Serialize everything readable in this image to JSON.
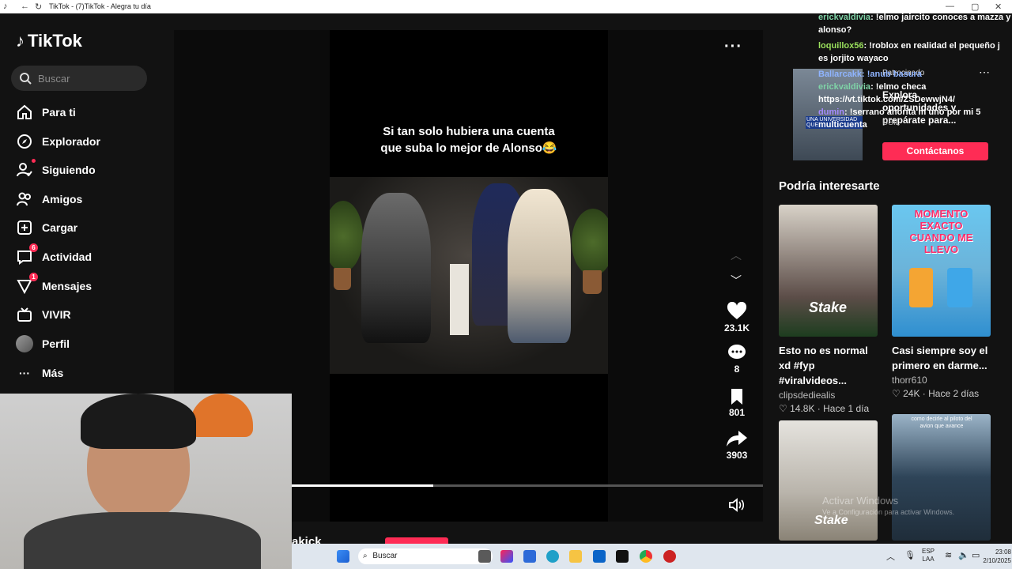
{
  "browser": {
    "title": "TikTok - (7)TikTok - Alegra tu día"
  },
  "sidebar": {
    "logo": "TikTok",
    "search_placeholder": "Buscar",
    "items": [
      {
        "label": "Para ti",
        "icon": "home-icon"
      },
      {
        "label": "Explorador",
        "icon": "compass-icon"
      },
      {
        "label": "Siguiendo",
        "icon": "following-icon"
      },
      {
        "label": "Amigos",
        "icon": "friends-icon"
      },
      {
        "label": "Cargar",
        "icon": "upload-icon"
      },
      {
        "label": "Actividad",
        "icon": "activity-icon",
        "badge": "6"
      },
      {
        "label": "Mensajes",
        "icon": "messages-icon",
        "badge": "1"
      },
      {
        "label": "VIVIR",
        "icon": "live-icon"
      },
      {
        "label": "Perfil",
        "icon": "avatar"
      },
      {
        "label": "Más",
        "icon": "more-icon"
      }
    ]
  },
  "video": {
    "caption_line1": "Si tan solo hubiera una cuenta",
    "caption_line2": "que suba lo mejor de Alonso😂",
    "likes": "23.1K",
    "comments": "8",
    "saves": "801",
    "shares": "3903",
    "progress": 0.3,
    "author_partial": "akick"
  },
  "chat": [
    {
      "user": "erickvaldivia",
      "text": ": !elmo jaircito conoces a mazza y alonso?"
    },
    {
      "user": "loquillox56",
      "text": ": !roblox en realidad el pequeño j es jorjito wayaco"
    },
    {
      "user": "Ballarcakk",
      "text": ": !anub basura"
    },
    {
      "user": "erickvaldivia",
      "text": ": !elmo checa https://vt.tiktok.com/ZSDewwjN4/"
    },
    {
      "user": "dumin",
      "text": ": !serrano ahorita m uno por mi 5 multicuenta"
    }
  ],
  "ad": {
    "sponsored": "Patrocinado",
    "title": "Explora oportunidades y prepárate para...",
    "brand": "USIL",
    "cta": "Contáctanos",
    "image_text": "UNA UNIVERSIDAD QUE"
  },
  "suggested": {
    "heading": "Podría interesarte",
    "cards": [
      {
        "title": "Esto no es normal xd #fyp #viralvideos...",
        "author": "clipsdediealis",
        "likes": "14.8K",
        "age": "Hace 1 día",
        "thumb_text": "Stake"
      },
      {
        "title": "Casi siempre soy el primero en darme...",
        "author": "thorr610",
        "likes": "24K",
        "age": "Hace 2 días",
        "thumb_text": "MOMENTO EXACTO CUANDO ME LLEVO"
      },
      {
        "title": "",
        "author": "",
        "likes": "",
        "age": "",
        "thumb_text": "Stake"
      },
      {
        "title": "",
        "author": "",
        "likes": "",
        "age": "",
        "thumb_text": "como decirle al piloto del avion que avance"
      }
    ]
  },
  "taskbar": {
    "search": "Buscar",
    "lang1": "ESP",
    "lang2": "LAA",
    "time": "23:08",
    "date": "2/10/2025"
  },
  "watermark": {
    "line1": "Activar Windows",
    "line2": "Ve a Configuración para activar Windows."
  },
  "colors": {
    "accent": "#fe2c55",
    "background": "#121212"
  }
}
